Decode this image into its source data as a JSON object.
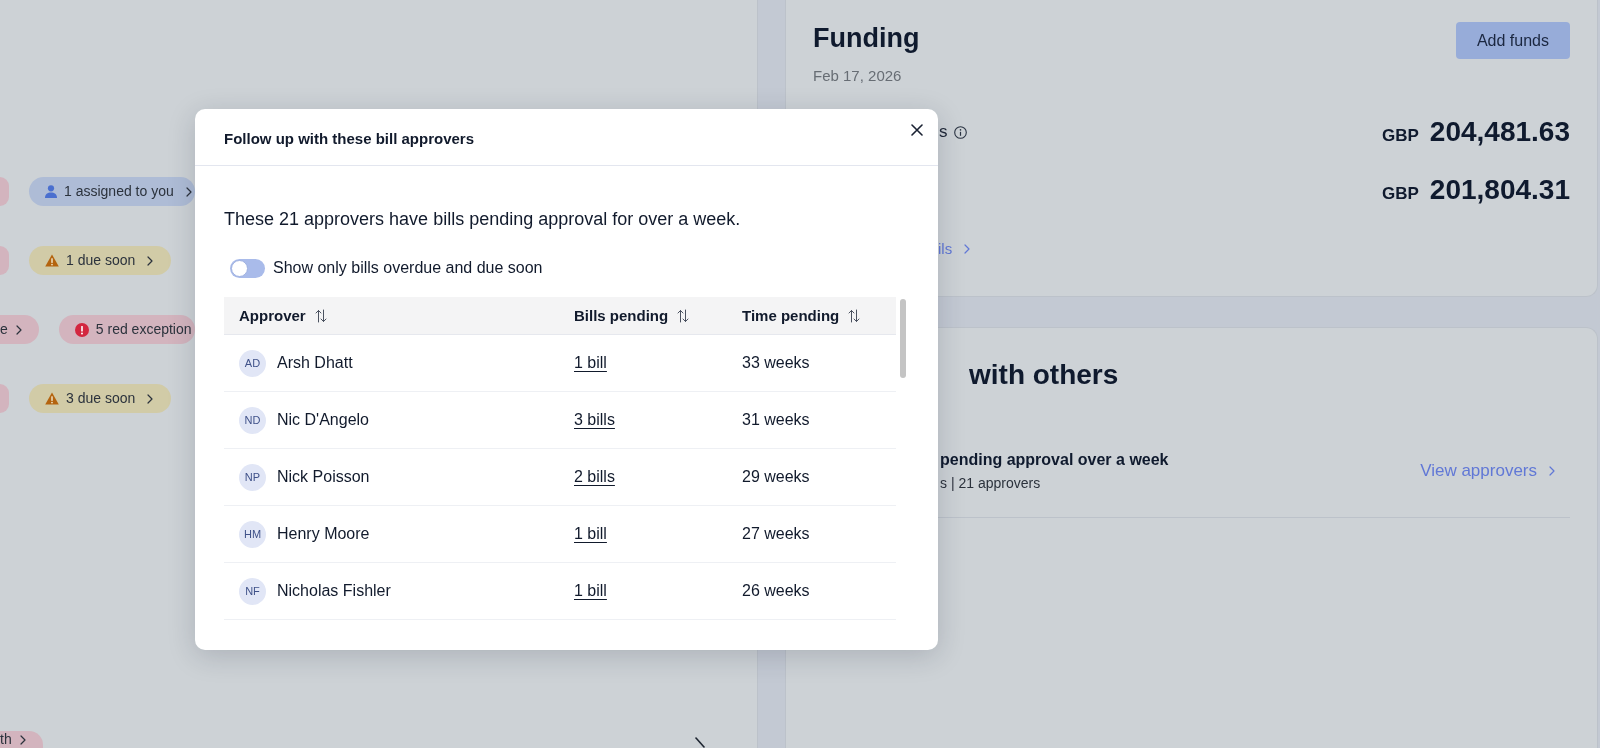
{
  "left_panel": {
    "tag_rows": [
      {
        "tags": [
          {
            "kind": "plain",
            "color": "#d3b4be"
          },
          {
            "kind": "person",
            "label": "1 assigned to you",
            "color": "#aebcd6"
          }
        ]
      },
      {
        "tags": [
          {
            "kind": "plain",
            "color": "#d3b4be"
          },
          {
            "kind": "warning",
            "label": "1 due soon",
            "color": "#d1cba7"
          }
        ]
      },
      {
        "tags": [
          {
            "kind": "plain",
            "label": "e",
            "color": "#d3b4be"
          },
          {
            "kind": "error",
            "label": "5 red exception",
            "color": "#d3b4be"
          }
        ]
      },
      {
        "tags": [
          {
            "kind": "plain",
            "color": "#d3b4be"
          },
          {
            "kind": "warning",
            "label": "3 due soon",
            "color": "#d1cba7"
          }
        ]
      }
    ],
    "bottom_tag": {
      "kind": "plain",
      "label": "th",
      "color": "#d3b4be"
    }
  },
  "funding_card": {
    "title": "Funding",
    "date": "Feb 17, 2026",
    "add_button": "Add funds",
    "balances": [
      {
        "label": "s",
        "info": true,
        "currency": "GBP",
        "amount": "204,481.63"
      },
      {
        "currency": "GBP",
        "amount": "201,804.31"
      }
    ],
    "details_link": "ils"
  },
  "approvals_card": {
    "title": "with others",
    "items": [
      {
        "title": "pending approval over a week",
        "subtitle": "s | 21 approvers",
        "link": "View approvers"
      }
    ]
  },
  "modal": {
    "title": "Follow up with these bill approvers",
    "description": "These 21 approvers have bills pending approval for over a week.",
    "toggle": {
      "label": "Show only bills overdue and due soon",
      "on": false
    },
    "table": {
      "columns": [
        "Approver",
        "Bills pending",
        "Time pending"
      ],
      "rows": [
        {
          "initials": "AD",
          "name": "Arsh Dhatt",
          "bills": "1 bill",
          "time": "33 weeks"
        },
        {
          "initials": "ND",
          "name": "Nic D'Angelo",
          "bills": "3 bills",
          "time": "31 weeks"
        },
        {
          "initials": "NP",
          "name": "Nick Poisson",
          "bills": "2 bills",
          "time": "29 weeks"
        },
        {
          "initials": "HM",
          "name": "Henry Moore",
          "bills": "1 bill",
          "time": "27 weeks"
        },
        {
          "initials": "NF",
          "name": "Nicholas Fishler",
          "bills": "1 bill",
          "time": "26 weeks"
        }
      ]
    }
  }
}
